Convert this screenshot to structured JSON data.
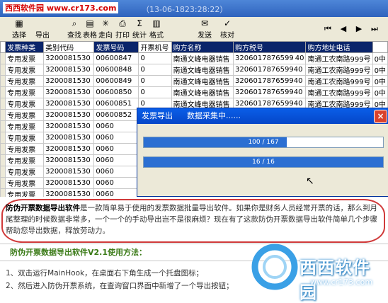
{
  "watermark_top": "西西软件园 www.cr173.com",
  "window_title": "（13-06-1823:28:22）",
  "toolbar": {
    "select": "选择",
    "export": "导出",
    "find": "查找",
    "table": "表格",
    "trend": "走向",
    "print": "打印",
    "stats": "统计",
    "format": "格式",
    "send": "发送",
    "verify": "核对"
  },
  "nav": {
    "first": "⏮",
    "prev": "◀",
    "next": "▶",
    "last": "⏭"
  },
  "columns": [
    "发票种类",
    "类别代码",
    "发票号码",
    "开票机号",
    "购方名称",
    "购方税号",
    "购方地址电话",
    ""
  ],
  "rows": [
    [
      "专用发票",
      "3200081530",
      "00600847",
      "0",
      "南通文峰电器销售",
      "3206017876599 40",
      "南通工农南路999号",
      "0中"
    ],
    [
      "专用发票",
      "3200081530",
      "00600848",
      "0",
      "南通文峰电器销售",
      "320601787659940",
      "南通工农南路999号",
      "0中"
    ],
    [
      "专用发票",
      "3200081530",
      "00600849",
      "0",
      "南通文峰电器销售",
      "320601787659940",
      "南通工农南路999号",
      "0中"
    ],
    [
      "专用发票",
      "3200081530",
      "00600850",
      "0",
      "南通文峰电器销售",
      "320601787659940",
      "南通工农南路999号",
      "0中"
    ],
    [
      "专用发票",
      "3200081530",
      "00600851",
      "0",
      "南通文峰电器销售",
      "320601787659940",
      "南通工农南路999号",
      "0中"
    ],
    [
      "专用发票",
      "3200081530",
      "00600852",
      "0",
      "南通文峰电器销售",
      "320601787659940",
      "南通工农南路999号",
      "0中"
    ],
    [
      "专用发票",
      "3200081530",
      "0060",
      "",
      "",
      "",
      "",
      ""
    ],
    [
      "专用发票",
      "3200081530",
      "0060",
      "",
      "",
      "",
      "",
      ""
    ],
    [
      "专用发票",
      "3200081530",
      "0060",
      "",
      "",
      "",
      "",
      ""
    ],
    [
      "专用发票",
      "3200081530",
      "0060",
      "",
      "",
      "",
      "",
      ""
    ],
    [
      "专用发票",
      "3200081530",
      "0060",
      "",
      "",
      "",
      "",
      ""
    ],
    [
      "专用发票",
      "3200081530",
      "0060",
      "",
      "",
      "",
      "",
      ""
    ],
    [
      "专用发票",
      "3200081530",
      "0060",
      "",
      "",
      "",
      "",
      ""
    ],
    [
      "专用发票",
      "3200081530",
      "00600860",
      "0",
      "南通文峰电器销售",
      "320601787659940",
      "南通工农南路999号",
      "0中"
    ]
  ],
  "dialog": {
    "title": "发票导出",
    "status": "数据采集中......",
    "close": "×",
    "bar1_text": "100 / 167",
    "bar1_progress": 0.599,
    "bar2_text": "16 / 16",
    "bar2_progress": 1.0
  },
  "description": {
    "bold": "防伪开票数据导出软件",
    "text": "是一款简单易于使用的发票数据批量导出软件。如果你是财务人员经常开票的话，那么到月尾整理的时候数据非常多，一个一个的手动导出岂不是很麻烦？现在有了这款防伪开票数据导出软件简单几个步骤帮助您导出数据，释放劳动力。"
  },
  "usage_title": "防伪开票数据导出软件V2.1使用方法：",
  "steps": [
    "1、双击运行MainHook，在桌面右下角生成一个托盘图标；",
    "2、然后进入防伪开票系统，在查询窗口界面中新增了一个导出按钮；"
  ],
  "logo": {
    "text": "西西软件园",
    "url": "www.cr173.com"
  }
}
